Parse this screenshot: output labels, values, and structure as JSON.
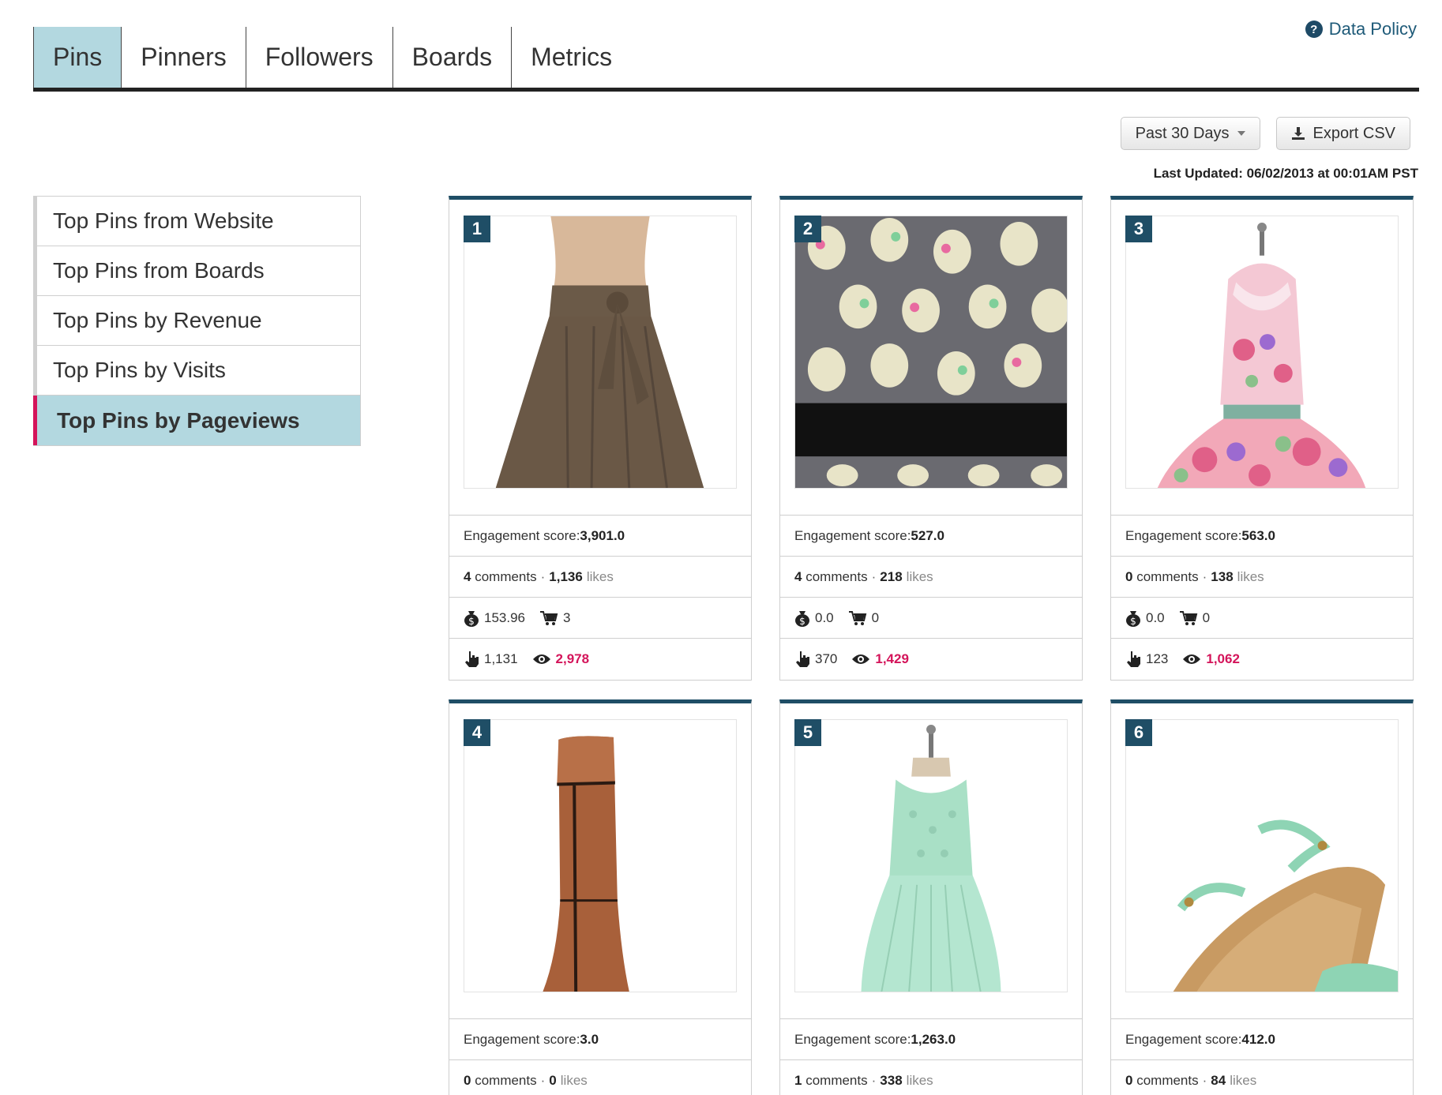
{
  "tabs": [
    {
      "label": "Pins",
      "active": true
    },
    {
      "label": "Pinners",
      "active": false
    },
    {
      "label": "Followers",
      "active": false
    },
    {
      "label": "Boards",
      "active": false
    },
    {
      "label": "Metrics",
      "active": false
    }
  ],
  "data_policy": {
    "icon": "question-circle-icon",
    "label": "Data Policy"
  },
  "toolbar": {
    "date_range": "Past 30 Days",
    "export_label": "Export CSV",
    "last_updated": "Last Updated: 06/02/2013 at 00:01AM PST"
  },
  "sidebar": {
    "items": [
      {
        "label": "Top Pins from Website",
        "active": false
      },
      {
        "label": "Top Pins from Boards",
        "active": false
      },
      {
        "label": "Top Pins by Revenue",
        "active": false
      },
      {
        "label": "Top Pins by Visits",
        "active": false
      },
      {
        "label": "Top Pins by Pageviews",
        "active": true
      }
    ]
  },
  "labels": {
    "engagement": "Engagement score: ",
    "comments": "comments",
    "likes": "likes",
    "separator": "·"
  },
  "colors": {
    "accent": "#1f4e66",
    "active_tab": "#b3d8e0",
    "highlight": "#d4145a"
  },
  "pins": [
    {
      "rank": "1",
      "image": "brown-skirt",
      "engagement": "3,901.0",
      "comments": "4",
      "likes": "1,136",
      "revenue": "153.96",
      "orders": "3",
      "visits": "1,131",
      "pageviews": "2,978"
    },
    {
      "rank": "2",
      "image": "sugar-skull-fabric",
      "engagement": "527.0",
      "comments": "4",
      "likes": "218",
      "revenue": "0.0",
      "orders": "0",
      "visits": "370",
      "pageviews": "1,429"
    },
    {
      "rank": "3",
      "image": "floral-dress",
      "engagement": "563.0",
      "comments": "0",
      "likes": "138",
      "revenue": "0.0",
      "orders": "0",
      "visits": "123",
      "pageviews": "1,062"
    },
    {
      "rank": "4",
      "image": "brown-boot",
      "engagement": "3.0",
      "comments": "0",
      "likes": "0",
      "revenue": "",
      "orders": "",
      "visits": "",
      "pageviews": ""
    },
    {
      "rank": "5",
      "image": "mint-dress",
      "engagement": "1,263.0",
      "comments": "1",
      "likes": "338",
      "revenue": "",
      "orders": "",
      "visits": "",
      "pageviews": ""
    },
    {
      "rank": "6",
      "image": "mint-sandal",
      "engagement": "412.0",
      "comments": "0",
      "likes": "84",
      "revenue": "",
      "orders": "",
      "visits": "",
      "pageviews": ""
    }
  ]
}
